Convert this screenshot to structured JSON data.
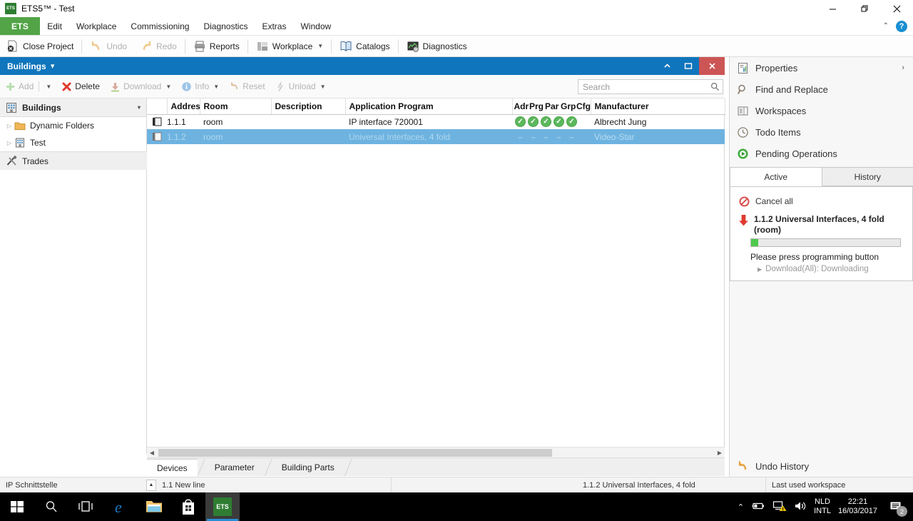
{
  "window": {
    "title": "ETS5™ - Test",
    "app_icon": "ets-logo-icon",
    "minimize": "—",
    "restore": "❐",
    "close": "✕"
  },
  "menubar": {
    "brand": "ETS",
    "items": [
      "Edit",
      "Workplace",
      "Commissioning",
      "Diagnostics",
      "Extras",
      "Window"
    ],
    "collapse_icon": "chevron-up-icon",
    "help_icon": "help-icon",
    "help_label": "?"
  },
  "toolbar": {
    "items": [
      {
        "label": "Close Project",
        "icon": "close-project-icon",
        "disabled": false,
        "caret": false
      },
      {
        "label": "Undo",
        "icon": "undo-icon",
        "disabled": true,
        "caret": false
      },
      {
        "label": "Redo",
        "icon": "redo-icon",
        "disabled": true,
        "caret": false
      },
      {
        "label": "Reports",
        "icon": "printer-icon",
        "disabled": false,
        "caret": false
      },
      {
        "label": "Workplace",
        "icon": "workplace-icon",
        "disabled": false,
        "caret": true
      },
      {
        "label": "Catalogs",
        "icon": "catalogs-icon",
        "disabled": false,
        "caret": false
      },
      {
        "label": "Diagnostics",
        "icon": "diagnostics-icon",
        "disabled": false,
        "caret": false
      }
    ]
  },
  "panel": {
    "title": "Buildings",
    "title_caret": "▾",
    "collapse": "⌃",
    "restore": "▭",
    "close": "✕",
    "toolbar": [
      {
        "label": "Add",
        "icon": "plus-icon",
        "disabled": true,
        "caret": true,
        "sep_after": false
      },
      {
        "label": "Delete",
        "icon": "delete-x-icon",
        "disabled": false,
        "caret": false
      },
      {
        "label": "Download",
        "icon": "download-icon",
        "disabled": true,
        "caret": true
      },
      {
        "label": "Info",
        "icon": "info-icon",
        "disabled": true,
        "caret": true
      },
      {
        "label": "Reset",
        "icon": "reset-icon",
        "disabled": true,
        "caret": false
      },
      {
        "label": "Unload",
        "icon": "unload-icon",
        "disabled": true,
        "caret": true
      }
    ]
  },
  "search": {
    "placeholder": "Search",
    "value": "",
    "icon": "search-icon"
  },
  "tree": {
    "header": {
      "label": "Buildings",
      "icon": "building-icon",
      "caret": "▾"
    },
    "items": [
      {
        "label": "Dynamic Folders",
        "icon": "folder-icon",
        "expander": "▷"
      },
      {
        "label": "Test",
        "icon": "building-small-icon",
        "expander": "▷"
      }
    ],
    "footer": {
      "label": "Trades",
      "icon": "tools-icon"
    }
  },
  "table": {
    "columns": [
      "Addres",
      "Room",
      "Description",
      "Application Program",
      "Adr",
      "Prg",
      "Par",
      "Grp",
      "Cfg",
      "Manufacturer"
    ],
    "status_columns": [
      "Adr",
      "Prg",
      "Par",
      "Grp",
      "Cfg"
    ],
    "rows": [
      {
        "address": "1.1.1",
        "room": "room",
        "description": "",
        "application_program": "IP interface 720001",
        "status": [
          "ok",
          "ok",
          "ok",
          "ok",
          "ok"
        ],
        "manufacturer": "Albrecht Jung",
        "selected": false
      },
      {
        "address": "1.1.2",
        "room": "room",
        "description": "",
        "application_program": "Universal Interfaces, 4 fold",
        "status": [
          "none",
          "none",
          "none",
          "none",
          "none"
        ],
        "manufacturer": "Video-Star",
        "selected": true
      }
    ],
    "status_ok_glyph": "✔",
    "status_none_glyph": "–"
  },
  "bottom_tabs": [
    {
      "label": "Devices",
      "active": true
    },
    {
      "label": "Parameter",
      "active": false
    },
    {
      "label": "Building Parts",
      "active": false
    }
  ],
  "sidebar": {
    "items": [
      {
        "label": "Properties",
        "icon": "properties-icon",
        "arrow": "›"
      },
      {
        "label": "Find and Replace",
        "icon": "magnifier-icon",
        "arrow": ""
      },
      {
        "label": "Workspaces",
        "icon": "workspaces-icon",
        "arrow": ""
      },
      {
        "label": "Todo Items",
        "icon": "clock-icon",
        "arrow": ""
      },
      {
        "label": "Pending Operations",
        "icon": "play-circle-icon",
        "arrow": ""
      }
    ],
    "tabs": [
      {
        "label": "Active",
        "active": true
      },
      {
        "label": "History",
        "active": false
      }
    ],
    "cancel_all": {
      "label": "Cancel all",
      "icon": "cancel-icon"
    },
    "operation": {
      "icon": "red-down-arrow-icon",
      "title": "1.1.2 Universal Interfaces, 4 fold (room)",
      "progress_percent": 5,
      "status": "Please press programming button",
      "sub_task": "Download(All): Downloading",
      "sub_expander": "▶"
    },
    "undo_history": {
      "label": "Undo History",
      "icon": "undo-orange-icon"
    }
  },
  "statusbar": {
    "left": "IP Schnittstelle",
    "up_glyph": "▲",
    "line": "1.1 New line",
    "device": "1.1.2 Universal Interfaces, 4 fold",
    "workspace": "Last used workspace"
  },
  "taskbar": {
    "buttons": [
      {
        "name": "start-icon",
        "label": ""
      },
      {
        "name": "search-icon",
        "label": ""
      },
      {
        "name": "task-view-icon",
        "label": ""
      }
    ],
    "apps": [
      {
        "name": "edge-icon",
        "label": "e",
        "active": false
      },
      {
        "name": "file-explorer-icon",
        "label": "",
        "active": false
      },
      {
        "name": "microsoft-store-icon",
        "label": "",
        "active": false
      },
      {
        "name": "ets-taskbar-icon",
        "label": "ETS",
        "active": true
      }
    ],
    "tray": {
      "overflow": "⌃",
      "battery_icon": "battery-icon",
      "network_icon": "network-warning-icon",
      "volume_icon": "volume-icon",
      "lang_line1": "NLD",
      "lang_line2": "INTL",
      "time": "22:21",
      "date": "16/03/2017",
      "notification_icon": "notification-icon",
      "notification_count": "2"
    }
  },
  "colors": {
    "accent_blue": "#0f75bc",
    "ets_green": "#52a447",
    "status_green": "#5cb85c",
    "selection_blue": "#6eb3e0",
    "close_red": "#c55555"
  }
}
